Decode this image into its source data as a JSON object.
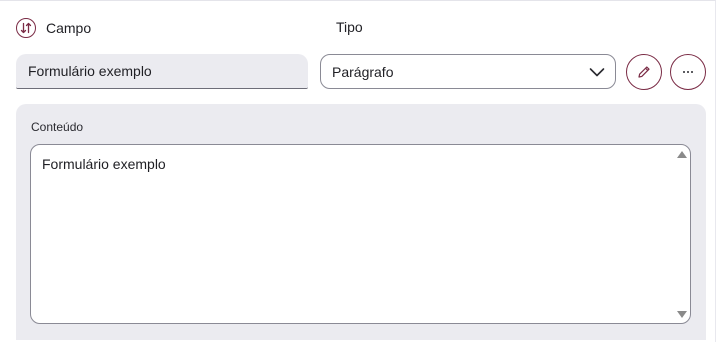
{
  "header": {
    "sort_icon": "sort-arrows-icon",
    "campo_label": "Campo",
    "tipo_label": "Tipo"
  },
  "field": {
    "name_value": "Formulário exemplo",
    "type_value": "Parágrafo"
  },
  "actions": {
    "edit_icon": "pencil-icon",
    "more_icon": "ellipsis-icon"
  },
  "content": {
    "label": "Conteúdo",
    "text": "Formulário exemplo"
  },
  "colors": {
    "accent": "#7a2b45",
    "panel_bg": "#ebebf0",
    "border": "#8a8a95"
  }
}
